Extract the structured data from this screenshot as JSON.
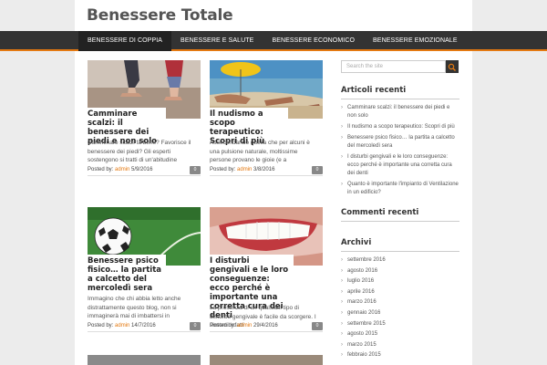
{
  "site": {
    "title": "Benessere Totale"
  },
  "nav": [
    "BENESSERE DI COPPIA",
    "BENESSERE E SALUTE",
    "BENESSERE ECONOMICO",
    "BENESSERE EMOZIONALE"
  ],
  "posts": [
    {
      "title": "Camminare scalzi: il benessere dei piedi e non solo",
      "excerpt": "Camminare scalzi fa bene? Favorisce il benessere dei piedi? Gli esperti sostengono si tratti di un'abitudine",
      "posted_by": "Posted by:",
      "author": "admin",
      "date": "5/9/2016",
      "comments": "0"
    },
    {
      "title": "Il nudismo a scopo terapeutico: Scopri di più",
      "excerpt": "Assecondando quella che per alcuni è una pulsione naturale, moltissime persone provano le gioie (e a",
      "posted_by": "Posted by:",
      "author": "admin",
      "date": "3/8/2016",
      "comments": "0"
    },
    {
      "title": "Benessere psico fisico… la partita a calcetto del mercoledì sera",
      "excerpt": "Immagino che chi abbia letto anche distrattamente questo blog, non si immaginerà mai di imbattersi in",
      "posted_by": "Posted by:",
      "author": "admin",
      "date": "14/7/2016",
      "comments": "0"
    },
    {
      "title": "I disturbi gengivali e le loro conseguenze: ecco perché è importante una corretta cura dei denti",
      "excerpt": "La presenza di un qualsiasi tipo di disturbo gengivale è facile da scorgere. I sintomi infatti",
      "posted_by": "Posted by:",
      "author": "admin",
      "date": "29/4/2016",
      "comments": "0"
    }
  ],
  "sidebar": {
    "search_placeholder": "Search the site",
    "recent_title": "Articoli recenti",
    "recent": [
      "Camminare scalzi: il benessere dei piedi e non solo",
      "Il nudismo a scopo terapeutico: Scopri di più",
      "Benessere psico fisico… la partita a calcetto del mercoledì sera",
      "I disturbi gengivali e le loro conseguenze: ecco perché è importante una corretta cura dei denti",
      "Quanto è importante l'impianto di Ventilazione in un edificio?"
    ],
    "comments_title": "Commenti recenti",
    "archive_title": "Archivi",
    "archives": [
      "settembre 2016",
      "agosto 2016",
      "luglio 2016",
      "aprile 2016",
      "marzo 2016",
      "gennaio 2016",
      "settembre 2015",
      "agosto 2015",
      "marzo 2015",
      "febbraio 2015"
    ]
  },
  "colors": {
    "accent": "#e47911",
    "nav_bg": "#333333"
  }
}
